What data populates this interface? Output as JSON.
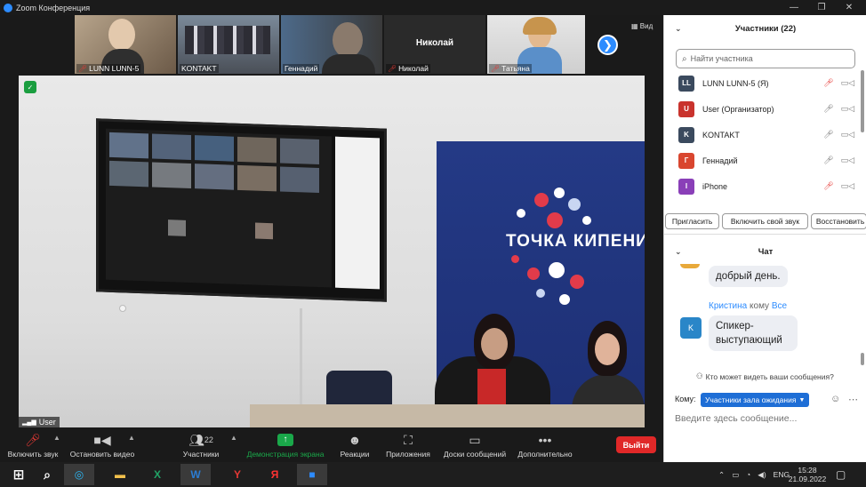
{
  "window": {
    "title": "Zoom Конференция",
    "controls": {
      "minimize": "—",
      "restore": "❐",
      "close": "✕"
    }
  },
  "strip": {
    "thumbs": [
      {
        "name": "LUNN LUNN-5",
        "muted": true
      },
      {
        "name": "KONTAKT",
        "muted": false
      },
      {
        "name": "Геннадий",
        "muted": false
      },
      {
        "name": "Николай",
        "muted": true,
        "caption": "Николай"
      },
      {
        "name": "Татьяна",
        "muted": true
      }
    ],
    "next_arrow": "❯",
    "view_label": "Вид"
  },
  "stage": {
    "speaker_label": "User",
    "banner_text": "ТОЧКА КИПЕНИ",
    "shield": "✓"
  },
  "toolbar": {
    "unmute": "Включить звук",
    "stop_video": "Остановить видео",
    "participants": "Участники",
    "participants_count": "22",
    "share": "Демонстрация экрана",
    "reactions": "Реакции",
    "apps": "Приложения",
    "whiteboards": "Доски сообщений",
    "more": "Дополнительно",
    "leave": "Выйти",
    "accent_green": "#1aa84a",
    "leave_color": "#e02828"
  },
  "participants_panel": {
    "title": "Участники (22)",
    "search_placeholder": "Найти участника",
    "items": [
      {
        "initials": "LL",
        "name": "LUNN LUNN-5 (Я)",
        "color": "#3b4a5e",
        "mic_muted": true
      },
      {
        "initials": "U",
        "name": "User (Организатор)",
        "color": "#c9332d",
        "mic_muted": false
      },
      {
        "initials": "K",
        "name": "KONTAKT",
        "color": "#3b4a5e",
        "mic_muted": false
      },
      {
        "initials": "Г",
        "name": "Геннадий",
        "color": "#d9462f",
        "mic_muted": false
      },
      {
        "initials": "I",
        "name": "iPhone",
        "color": "#8a3fb8",
        "mic_muted": true
      }
    ],
    "buttons": [
      "Пригласить",
      "Включить свой звук",
      "Восстановить"
    ]
  },
  "chat_panel": {
    "title": "Чат",
    "messages": [
      {
        "text": "добрый день."
      },
      {
        "sender": "Кристина",
        "to_word": "кому",
        "to": "Все",
        "avatar": "K",
        "text_line1": "Спикер-",
        "text_line2": "выступающий"
      }
    ],
    "visibility_note": "Кто может видеть ваши сообщения?",
    "to_label": "Кому:",
    "to_value": "Участники зала ожидания",
    "input_placeholder": "Введите здесь сообщение..."
  },
  "taskbar": {
    "lang": "ENG",
    "time": "15:28",
    "date": "21.09.2022"
  }
}
